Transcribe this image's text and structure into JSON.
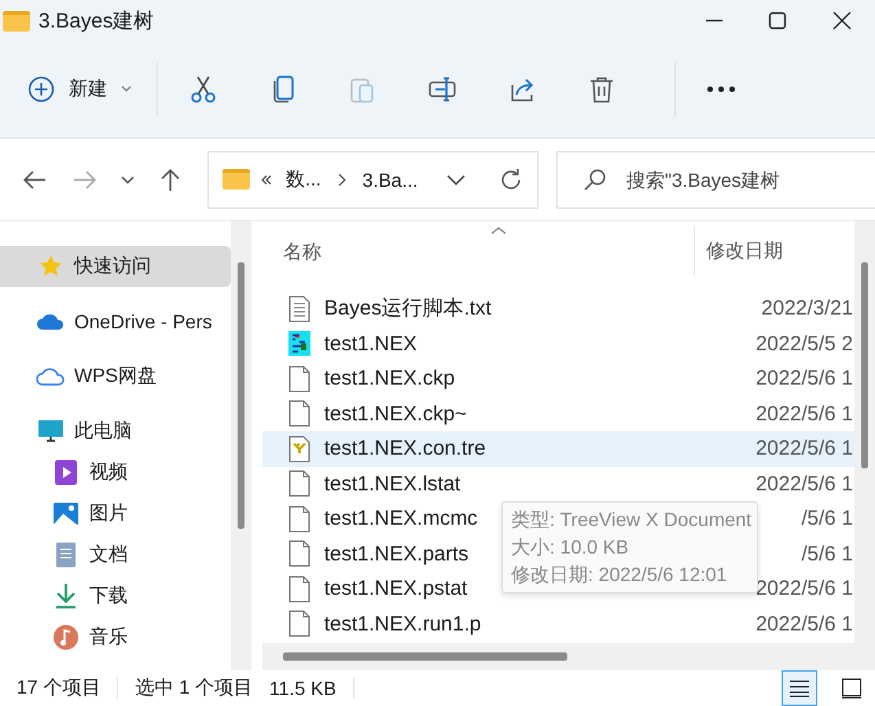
{
  "window": {
    "title": "3.Bayes建树"
  },
  "toolbar": {
    "new_label": "新建"
  },
  "address": {
    "crumbs": [
      "数...",
      "3.Ba..."
    ]
  },
  "search": {
    "placeholder": "搜索\"3.Bayes建树"
  },
  "sidebar": {
    "items": [
      {
        "label": "快速访问",
        "kind": "star",
        "selected": true
      },
      {
        "label": "OneDrive - Pers",
        "kind": "cloud",
        "selected": false
      },
      {
        "label": "WPS网盘",
        "kind": "cloudline",
        "selected": false
      },
      {
        "label": "此电脑",
        "kind": "monitor",
        "selected": false,
        "children": [
          {
            "label": "视频",
            "kind": "video",
            "selected": false
          },
          {
            "label": "图片",
            "kind": "image",
            "selected": false
          },
          {
            "label": "文档",
            "kind": "doc",
            "selected": false
          },
          {
            "label": "下载",
            "kind": "download",
            "selected": false
          },
          {
            "label": "音乐",
            "kind": "music",
            "selected": false
          }
        ]
      }
    ]
  },
  "table": {
    "columns": [
      "名称",
      "修改日期"
    ],
    "rows": [
      {
        "name": "Bayes运行脚本.txt",
        "date": "2022/3/21",
        "kind": "text",
        "selected": false
      },
      {
        "name": "test1.NEX",
        "date": "2022/5/5 2",
        "kind": "nexus",
        "selected": false
      },
      {
        "name": "test1.NEX.ckp",
        "date": "2022/5/6 1",
        "kind": "plain",
        "selected": false
      },
      {
        "name": "test1.NEX.ckp~",
        "date": "2022/5/6 1",
        "kind": "plain",
        "selected": false
      },
      {
        "name": "test1.NEX.con.tre",
        "date": "2022/5/6 1",
        "kind": "tree",
        "selected": true
      },
      {
        "name": "test1.NEX.lstat",
        "date": "2022/5/6 1",
        "kind": "plain",
        "selected": false
      },
      {
        "name": "test1.NEX.mcmc",
        "date": "/5/6 1",
        "kind": "plain",
        "selected": false
      },
      {
        "name": "test1.NEX.parts",
        "date": "/5/6 1",
        "kind": "plain",
        "selected": false
      },
      {
        "name": "test1.NEX.pstat",
        "date": "2022/5/6 1",
        "kind": "plain",
        "selected": false
      },
      {
        "name": "test1.NEX.run1.p",
        "date": "2022/5/6 1",
        "kind": "plain",
        "selected": false
      }
    ]
  },
  "tooltip": {
    "lines": [
      "类型: TreeView X Document",
      "大小: 10.0 KB",
      "修改日期: 2022/5/6 12:01"
    ]
  },
  "status_bar": {
    "count": "17 个项目",
    "selection": "选中 1 个项目",
    "size": "11.5 KB"
  }
}
